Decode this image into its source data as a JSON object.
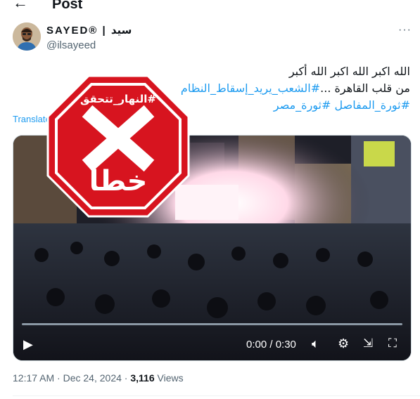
{
  "header": {
    "back_icon": "arrow-left-icon",
    "title": "Post"
  },
  "author": {
    "display_name": "SAYED® | سيد",
    "handle": "@ilsayeed",
    "more_icon": "more-icon"
  },
  "tweet": {
    "line1": "الله اكبر الله اكبر الله أكبر",
    "line2_prefix": "من قلب القاهرة ...",
    "hashtag1": "#الشعب_يريد_إسقاط_النظام",
    "hashtag2": "#ثورة_المفاصل",
    "hashtag3": "#ثورة_مصر"
  },
  "translate_label": "Translate post",
  "stamp": {
    "top_text": "#النهار_تتحقق",
    "verdict": "خطأ",
    "color": "#d7141f"
  },
  "video": {
    "time": "0:00 / 0:30",
    "progress": 0,
    "play_icon": "play-icon",
    "volume_icon": "volume-icon",
    "settings_icon": "settings-icon",
    "popout_icon": "popout-icon",
    "fullscreen_icon": "fullscreen-icon"
  },
  "meta": {
    "time": "12:17 AM",
    "sep": "·",
    "date": "Dec 24, 2024",
    "views_count": "3,116",
    "views_label": "Views"
  }
}
